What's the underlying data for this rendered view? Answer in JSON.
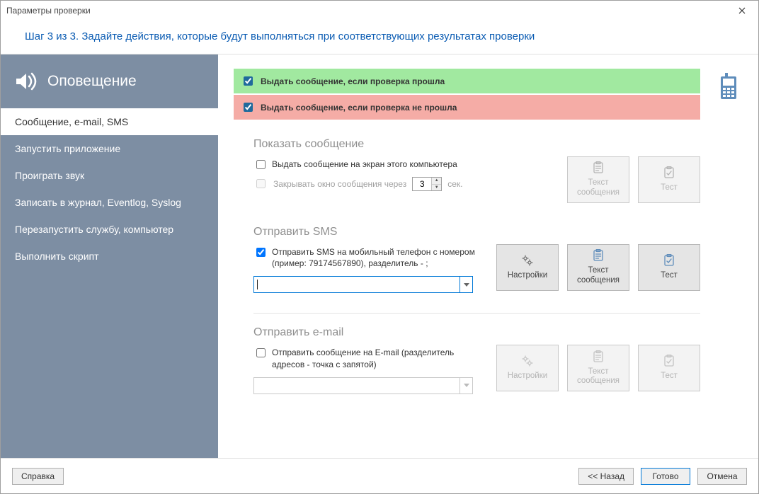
{
  "window": {
    "title": "Параметры проверки"
  },
  "step_header": "Шаг 3 из 3. Задайте действия, которые будут выполняться при соответствующих результатах проверки",
  "sidebar": {
    "header": "Оповещение",
    "items": [
      {
        "label": "Сообщение, e-mail, SMS"
      },
      {
        "label": "Запустить приложение"
      },
      {
        "label": "Проиграть звук"
      },
      {
        "label": "Записать в журнал, Eventlog, Syslog"
      },
      {
        "label": "Перезапустить службу, компьютер"
      },
      {
        "label": "Выполнить скрипт"
      }
    ],
    "active_index": 0
  },
  "banners": {
    "pass": "Выдать сообщение, если проверка прошла",
    "fail": "Выдать сообщение, если проверка не прошла"
  },
  "sections": {
    "message": {
      "title": "Показать сообщение",
      "screen_cb": "Выдать сообщение на экран этого компьютера",
      "close_cb": "Закрывать окно сообщения через",
      "seconds_value": "3",
      "seconds_unit": "сек.",
      "btn_text": "Текст сообщения",
      "btn_test": "Тест"
    },
    "sms": {
      "title": "Отправить SMS",
      "cb": "Отправить SMS на мобильный телефон с номером (пример: 79174567890), разделитель - ;",
      "btn_settings": "Настройки",
      "btn_text": "Текст сообщения",
      "btn_test": "Тест"
    },
    "email": {
      "title": "Отправить e-mail",
      "cb": "Отправить сообщение на E-mail (разделитель адресов - точка с запятой)",
      "btn_settings": "Настройки",
      "btn_text": "Текст сообщения",
      "btn_test": "Тест"
    }
  },
  "footer": {
    "help": "Справка",
    "back": "<< Назад",
    "finish": "Готово",
    "cancel": "Отмена"
  }
}
